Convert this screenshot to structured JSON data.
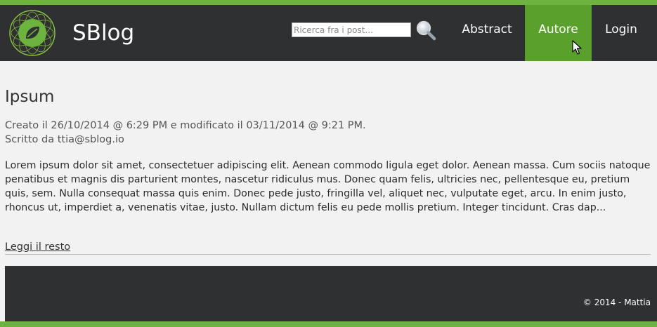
{
  "header": {
    "brand": "SBlog",
    "search_placeholder": "Ricerca fra i post...",
    "nav": {
      "abstract": "Abstract",
      "autore": "Autore",
      "login": "Login"
    }
  },
  "post": {
    "title": "Ipsum",
    "meta_line1": "Creato il 26/10/2014 @ 6:29 PM e modificato il 03/11/2014 @ 9:21 PM.",
    "meta_line2": "Scritto da ttia@sblog.io",
    "excerpt": "Lorem ipsum dolor sit amet, consectetuer adipiscing elit. Aenean commodo ligula eget dolor. Aenean massa. Cum sociis natoque penatibus et magnis dis parturient montes, nascetur ridiculus mus. Donec quam felis, ultricies nec, pellentesque eu, pretium quis, sem. Nulla consequat massa quis enim. Donec pede justo, fringilla vel, aliquet nec, vulputate eget, arcu. In enim justo, rhoncus ut, imperdiet a, venenatis vitae, justo. Nullam dictum felis eu pede mollis pretium. Integer tincidunt. Cras dap...",
    "read_more": "Leggi il resto"
  },
  "footer": {
    "copyright": "© 2014 - Mattia"
  },
  "colors": {
    "accent": "#6db33f",
    "nav_active": "#5aa02c",
    "header_bg": "#2f3032",
    "page_bg": "#f2f2f2"
  },
  "icons": {
    "logo": "leaf-logo-icon",
    "search": "search-icon",
    "cursor": "mouse-pointer-icon"
  }
}
